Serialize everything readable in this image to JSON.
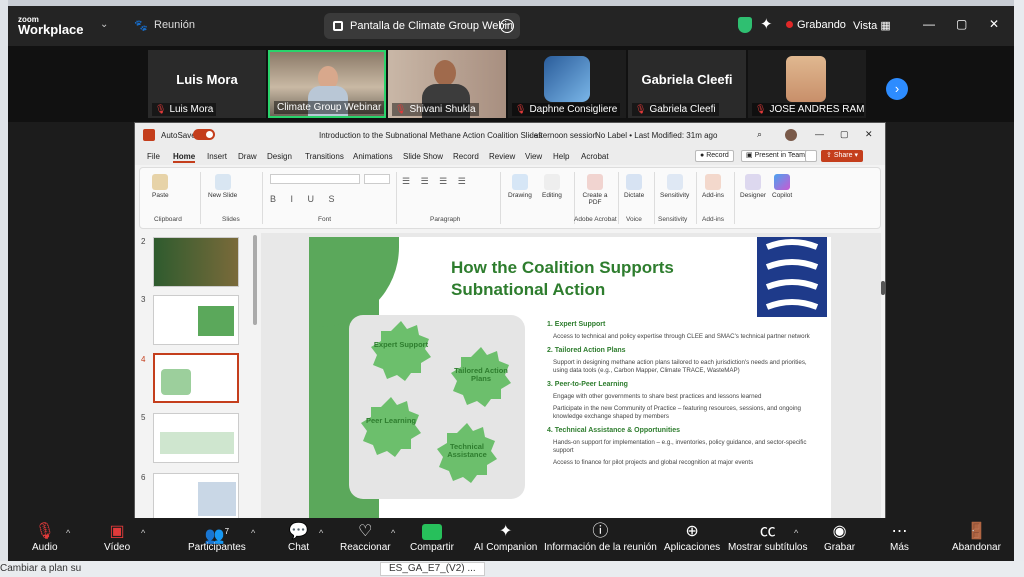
{
  "desktop": {
    "taskbar_left": "Cambiar a plan su",
    "taskbar_doc": "ES_GA_E7_(V2) ..."
  },
  "app": {
    "brand_small": "zoom",
    "brand_large": "Workplace",
    "meeting_name": "Reunión"
  },
  "share_pill": {
    "label": "Pantalla de Climate Group Webin"
  },
  "status": {
    "recording": "Grabando",
    "view": "Vista"
  },
  "participants": [
    {
      "display": "Luis Mora",
      "label": "Luis Mora",
      "muted": true,
      "video": false
    },
    {
      "display": "",
      "label": "Climate Group Webinar",
      "muted": false,
      "video": true,
      "active": true
    },
    {
      "display": "",
      "label": "Shivani Shukla",
      "muted": true,
      "video": true
    },
    {
      "display": "",
      "label": "Daphne Consigliere",
      "muted": true,
      "video": true
    },
    {
      "display": "Gabriela Cleefi",
      "label": "Gabriela Cleefi",
      "muted": true,
      "video": false
    },
    {
      "display": "",
      "label": "JOSE ANDRES RAMIRE...",
      "muted": true,
      "video": true
    }
  ],
  "ppt": {
    "autosave": "AutoSave",
    "doc_title": "Introduction to the Subnational Methane Action Coalition Slides",
    "session": "- afternoon session",
    "label": "No Label • Last Modified: 31m ago",
    "tabs": [
      "File",
      "Home",
      "Insert",
      "Draw",
      "Design",
      "Transitions",
      "Animations",
      "Slide Show",
      "Record",
      "Review",
      "View",
      "Help",
      "Acrobat"
    ],
    "record_btn": "Record",
    "present_btn": "Present in Teams",
    "share_btn": "Share",
    "ribbon_groups": {
      "clipboard": "Clipboard",
      "slides": "Slides",
      "font": "Font",
      "paragraph": "Paragraph",
      "adobe": "Adobe Acrobat",
      "voice": "Voice",
      "sensitivity": "Sensitivity",
      "addins": "Add-ins"
    },
    "ribbon_buttons": {
      "paste": "Paste",
      "new_slide": "New Slide",
      "drawing": "Drawing",
      "editing": "Editing",
      "create_pdf": "Create a PDF",
      "dictate": "Dictate",
      "sensitivity": "Sensitivity",
      "addins": "Add-ins",
      "designer": "Designer",
      "copilot": "Copilot"
    },
    "slide_numbers": [
      "2",
      "3",
      "4",
      "5",
      "6"
    ],
    "slide": {
      "title_line1": "How the Coalition Supports",
      "title_line2": "Subnational Action",
      "gears": [
        "Expert Support",
        "Tailored Action Plans",
        "Peer Learning",
        "Technical Assistance"
      ],
      "sections": [
        {
          "head": "1. Expert Support",
          "items": [
            "Access to technical and policy expertise through CLEE and SMAC's technical partner network"
          ]
        },
        {
          "head": "2. Tailored Action Plans",
          "items": [
            "Support in designing methane action plans tailored to each jurisdiction's needs and priorities, using data tools (e.g., Carbon Mapper, Climate TRACE, WasteMAP)"
          ]
        },
        {
          "head": "3. Peer-to-Peer Learning",
          "items": [
            "Engage with other governments to share best practices and lessons learned",
            "Participate in the new Community of Practice – featuring resources, sessions, and ongoing knowledge exchange shaped by members"
          ]
        },
        {
          "head": "4. Technical Assistance & Opportunities",
          "items": [
            "Hands-on support for implementation – e.g., inventories, policy guidance, and sector-specific support",
            "Access to finance for pilot projects and global recognition at major events"
          ]
        }
      ]
    }
  },
  "toolbar": {
    "audio": "Audio",
    "video": "Vídeo",
    "participants": "Participantes",
    "participants_count": "7",
    "chat": "Chat",
    "reactions": "Reaccionar",
    "share": "Compartir",
    "companion": "AI Companion",
    "info": "Información de la reunión",
    "apps": "Aplicaciones",
    "subtitles": "Mostrar subtítulos",
    "record": "Grabar",
    "more": "Más",
    "leave": "Abandonar"
  },
  "colors": {
    "accent": "#2d8cff",
    "record": "#e02828",
    "share": "#27c05b",
    "ppt": "#c43e1c",
    "slide_green": "#5ba85b"
  }
}
